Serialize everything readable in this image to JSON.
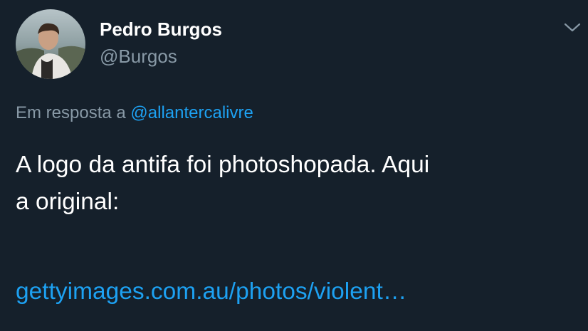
{
  "author": {
    "display_name": "Pedro Burgos",
    "handle": "@Burgos"
  },
  "reply": {
    "prefix": "Em resposta a",
    "mention": "@allantercalivre"
  },
  "tweet": {
    "line1": "A logo da antifa foi photoshopada. Aqui",
    "line2": "a original:",
    "link_text": "gettyimages.com.au/photos/violent…"
  },
  "icons": {
    "menu": "chevron-down-icon",
    "avatar": "avatar-photo"
  },
  "colors": {
    "background": "#15202b",
    "primary_text": "#ffffff",
    "secondary_text": "#8899a6",
    "link": "#1da1f2"
  }
}
